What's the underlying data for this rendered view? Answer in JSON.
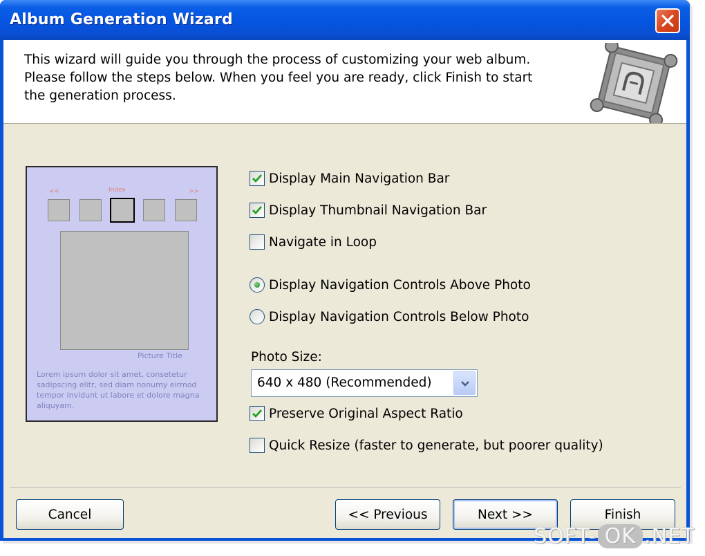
{
  "window": {
    "title": "Album Generation Wizard"
  },
  "header": {
    "description": "This wizard will guide you through the process of customizing your web album.\nPlease follow the steps below. When you feel you are ready, click Finish to start\nthe generation process."
  },
  "preview": {
    "nav_prev": "<<",
    "nav_index": "Index",
    "nav_next": ">>",
    "picture_title": "Picture Title",
    "description": "Lorem ipsum dolor sit amet, consetetur sadipscing elitr, sed diam nonumy eirmod tempor invidunt ut labore et dolore magna aliquyam."
  },
  "options": {
    "main_nav_bar": {
      "label": "Display Main Navigation Bar",
      "checked": true
    },
    "thumb_nav_bar": {
      "label": "Display Thumbnail Navigation Bar",
      "checked": true
    },
    "navigate_loop": {
      "label": "Navigate in Loop",
      "checked": false
    },
    "nav_above": {
      "label": "Display Navigation Controls Above Photo",
      "selected": true
    },
    "nav_below": {
      "label": "Display Navigation Controls Below Photo",
      "selected": false
    },
    "photo_size_label": "Photo Size:",
    "photo_size_value": "640 x 480 (Recommended)",
    "preserve_aspect": {
      "label": "Preserve Original Aspect Ratio",
      "checked": true
    },
    "quick_resize": {
      "label": "Quick Resize (faster to generate, but poorer quality)",
      "checked": false
    }
  },
  "buttons": {
    "cancel": "Cancel",
    "previous": "<< Previous",
    "next": "Next  >>",
    "finish": "Finish"
  },
  "watermark": {
    "part1": "SOFT-",
    "part2": "OK",
    "part3": ".NET"
  },
  "colors": {
    "titlebar": "#0554e0",
    "dialog_bg": "#ece9d8",
    "preview_bg": "#ccccf2",
    "check_green": "#21a121"
  }
}
